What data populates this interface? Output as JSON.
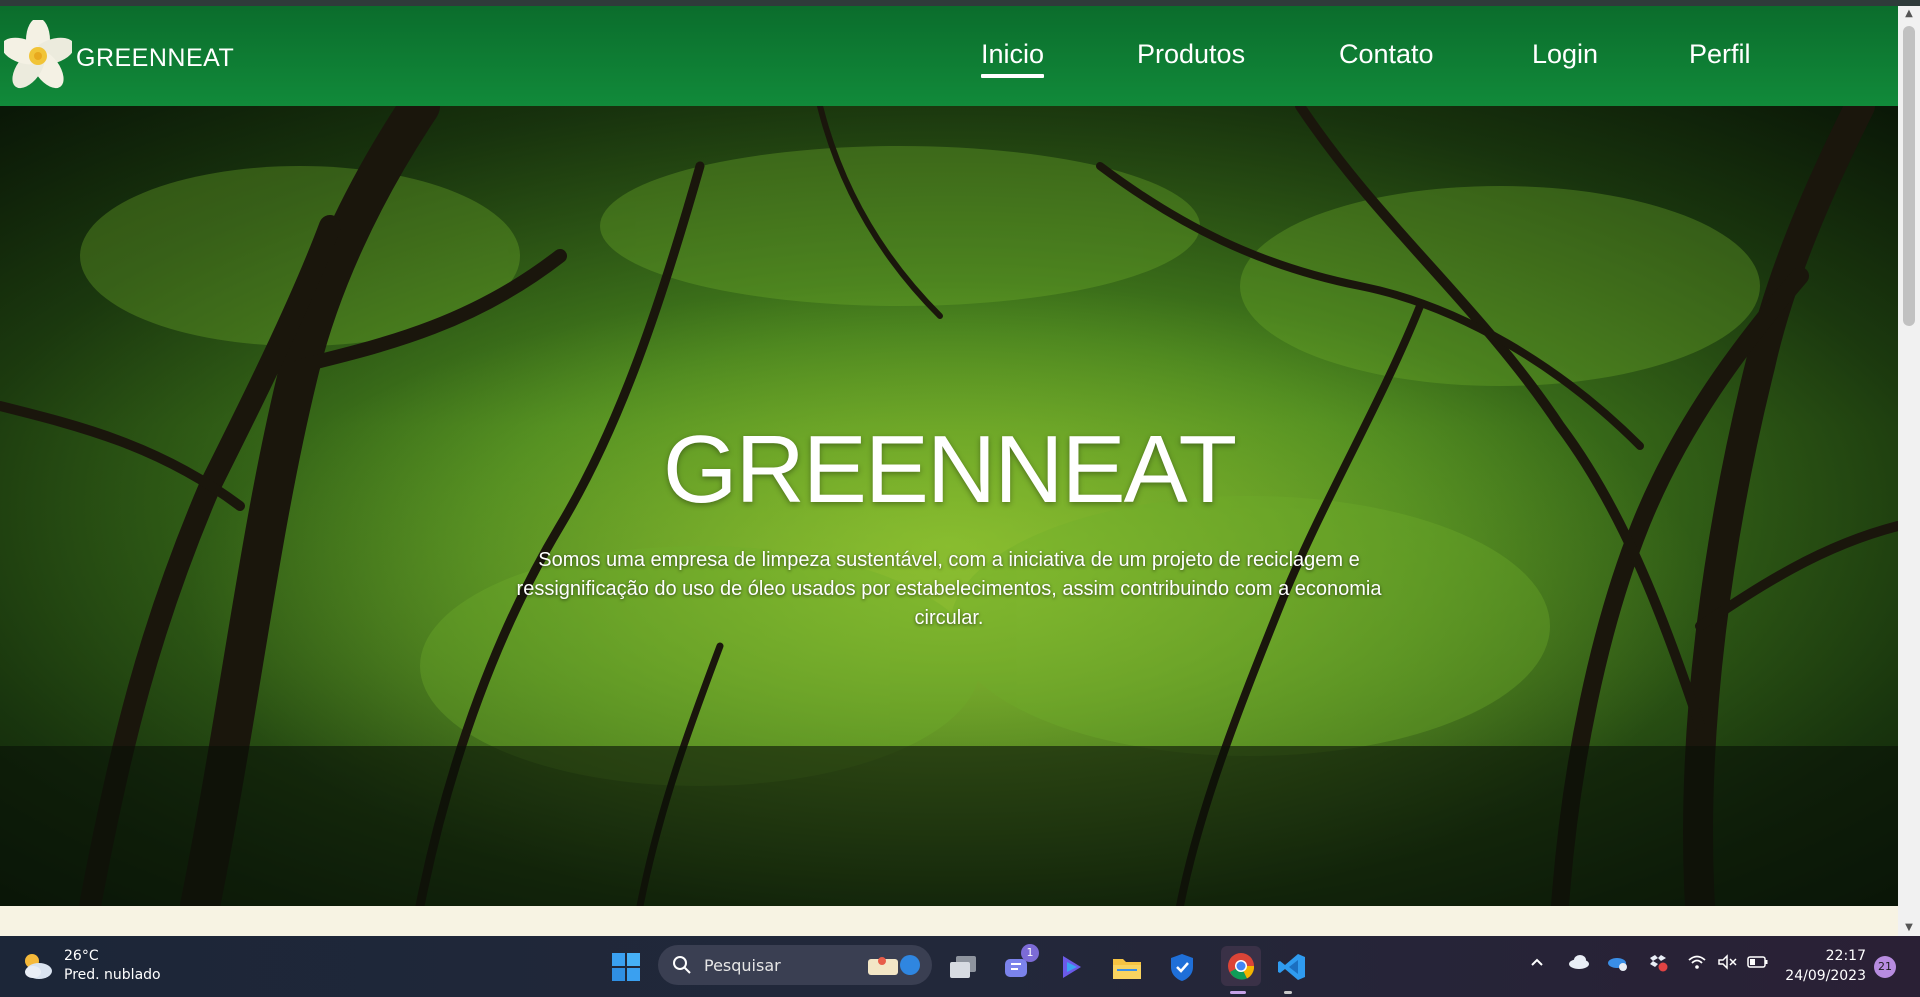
{
  "site": {
    "brand": "GREENNEAT",
    "nav": [
      {
        "label": "Inicio",
        "active": true
      },
      {
        "label": "Produtos",
        "active": false
      },
      {
        "label": "Contato",
        "active": false
      },
      {
        "label": "Login",
        "active": false
      },
      {
        "label": "Perfil",
        "active": false
      }
    ]
  },
  "hero": {
    "title": "GREENNEAT",
    "description": "Somos uma empresa de limpeza sustentável, com a iniciativa de um projeto de reciclagem e ressignificação do uso de óleo usados por estabelecimentos, assim contribuindo com a economia circular."
  },
  "taskbar": {
    "weather": {
      "temp": "26°C",
      "desc": "Pred. nublado",
      "icon": "partly-cloudy-icon"
    },
    "search_placeholder": "Pesquisar",
    "teams_badge": "1",
    "clock": {
      "time": "22:17",
      "date": "24/09/2023"
    },
    "notification_count": "21",
    "pinned": [
      "windows-start-icon",
      "task-view-icon",
      "teams-chat-icon",
      "copilot-icon",
      "file-explorer-icon",
      "security-icon",
      "chrome-icon",
      "vscode-icon"
    ]
  },
  "colors": {
    "nav_green": "#0b6d2c",
    "page_bg": "#f7f3e3",
    "taskbar": "#1c2638"
  }
}
